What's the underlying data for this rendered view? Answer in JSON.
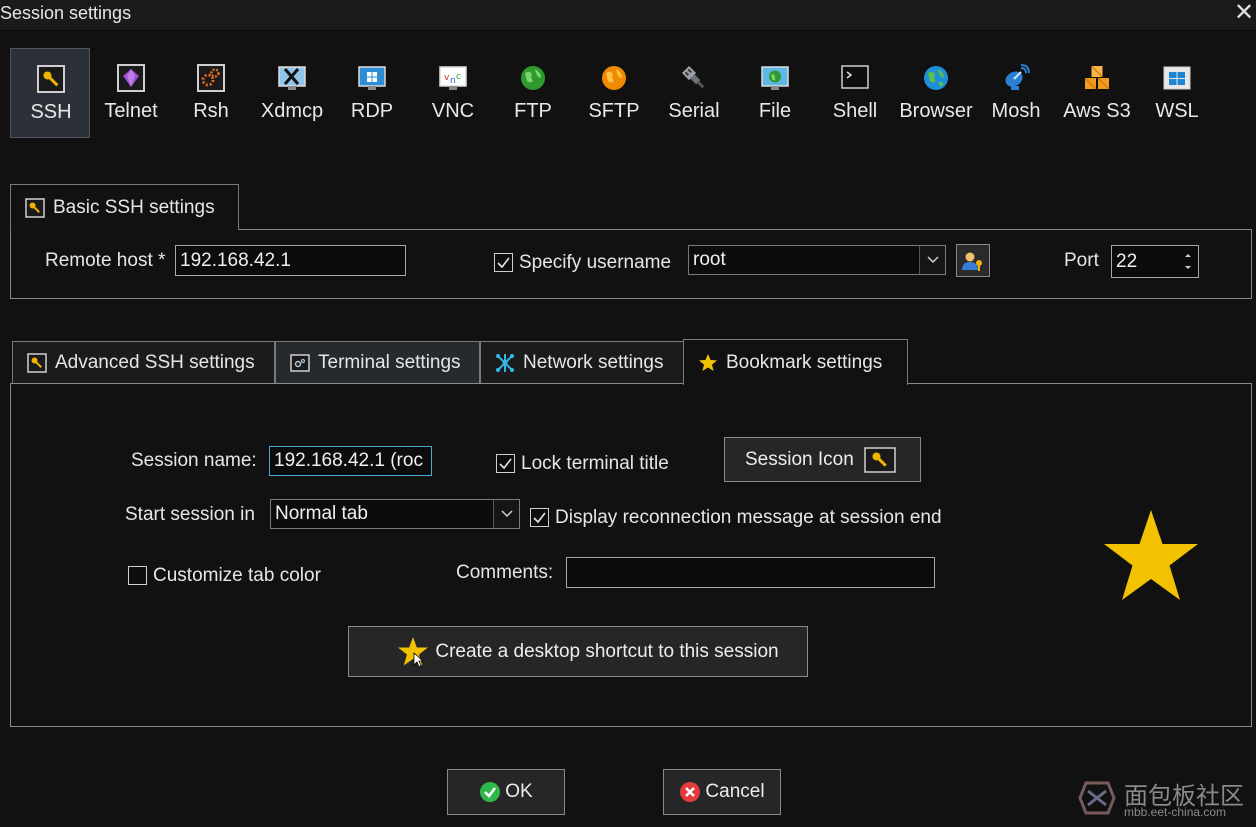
{
  "window": {
    "title": "Session settings",
    "close_icon": "close-icon"
  },
  "protocols": [
    {
      "label": "SSH",
      "icon": "ssh-key-icon",
      "selected": true
    },
    {
      "label": "Telnet",
      "icon": "telnet-gem-icon"
    },
    {
      "label": "Rsh",
      "icon": "rsh-gears-icon"
    },
    {
      "label": "Xdmcp",
      "icon": "xdmcp-monitor-icon"
    },
    {
      "label": "RDP",
      "icon": "rdp-monitor-icon"
    },
    {
      "label": "VNC",
      "icon": "vnc-monitor-icon"
    },
    {
      "label": "FTP",
      "icon": "ftp-globe-icon"
    },
    {
      "label": "SFTP",
      "icon": "sftp-globe-icon"
    },
    {
      "label": "Serial",
      "icon": "serial-plug-icon"
    },
    {
      "label": "File",
      "icon": "file-monitor-icon"
    },
    {
      "label": "Shell",
      "icon": "shell-terminal-icon"
    },
    {
      "label": "Browser",
      "icon": "browser-globe-icon"
    },
    {
      "label": "Mosh",
      "icon": "mosh-satellite-icon"
    },
    {
      "label": "Aws S3",
      "icon": "aws-s3-cubes-icon"
    },
    {
      "label": "WSL",
      "icon": "wsl-windows-icon"
    }
  ],
  "basic": {
    "tab_label": "Basic SSH settings",
    "remote_host_label": "Remote host *",
    "remote_host_value": "192.168.42.1",
    "specify_username_label": "Specify username",
    "specify_username_checked": true,
    "username_value": "root",
    "port_label": "Port",
    "port_value": "22"
  },
  "tabs": [
    {
      "label": "Advanced SSH settings",
      "icon": "wrench-icon"
    },
    {
      "label": "Terminal settings",
      "icon": "terminal-icon"
    },
    {
      "label": "Network settings",
      "icon": "network-icon"
    },
    {
      "label": "Bookmark settings",
      "icon": "star-icon",
      "active": true
    }
  ],
  "bookmark": {
    "session_name_label": "Session name:",
    "session_name_value": "192.168.42.1 (roc",
    "lock_title_label": "Lock terminal title",
    "lock_title_checked": true,
    "session_icon_label": "Session Icon",
    "start_session_label": "Start session in",
    "start_session_value": "Normal tab",
    "reconnect_label": "Display reconnection message at session end",
    "reconnect_checked": true,
    "customize_tab_color_label": "Customize tab color",
    "customize_tab_color_checked": false,
    "comments_label": "Comments:",
    "comments_value": "",
    "shortcut_button_label": "Create a desktop shortcut to this session"
  },
  "footer": {
    "ok_label": "OK",
    "cancel_label": "Cancel"
  },
  "watermark": {
    "text_cn": "面包板社区",
    "text_url": "mbb.eet-china.com"
  },
  "colors": {
    "star": "#f2c200",
    "accent": "#4aa7d6",
    "ok": "#2eb84b",
    "cancel": "#e33b3b"
  }
}
